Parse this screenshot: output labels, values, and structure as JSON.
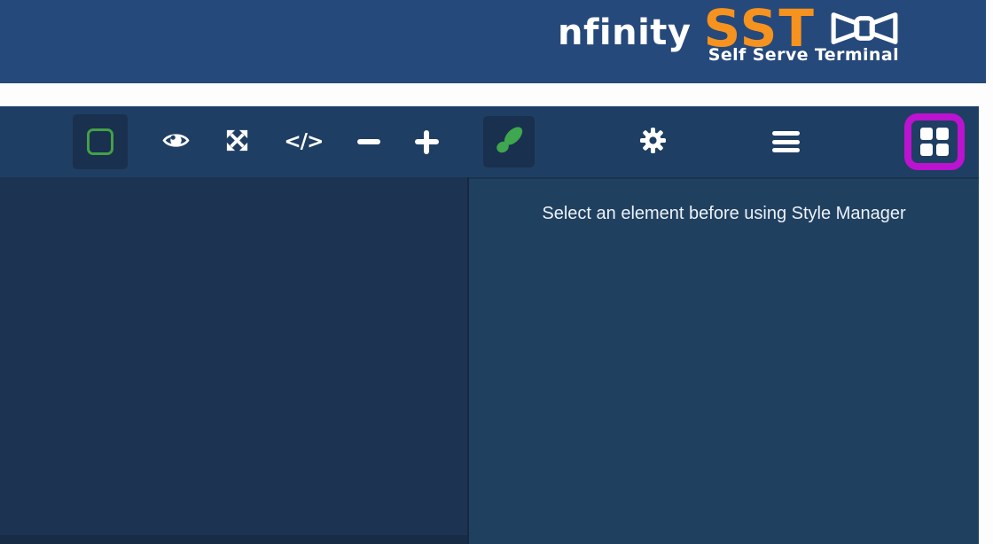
{
  "header": {
    "logo_text": "nfinity",
    "logo_acronym": "SST",
    "logo_tagline": "Self Serve Terminal"
  },
  "toolbar": {
    "code_glyph": "</>",
    "left_icons": [
      "square-outline-icon",
      "eye-icon",
      "expand-arrows-icon",
      "code-icon",
      "minus-icon",
      "plus-icon"
    ],
    "right_icons": [
      "paintbrush-icon",
      "gear-icon",
      "hamburger-icon",
      "blocks-grid-icon"
    ]
  },
  "style_panel": {
    "message": "Select an element before using Style Manager"
  },
  "colors": {
    "header_bg": "#26497B",
    "logo_orange": "#F6921E",
    "toolbar_bg": "#1F3E63",
    "canvas_bg": "#1C3452",
    "panel_bg": "#204060",
    "active_button_bg": "#19304E",
    "icon_green": "#3FA74F",
    "square_icon_green": "#43A047",
    "highlight_magenta": "#BB13CF",
    "icon_white": "#FFFFFF"
  }
}
